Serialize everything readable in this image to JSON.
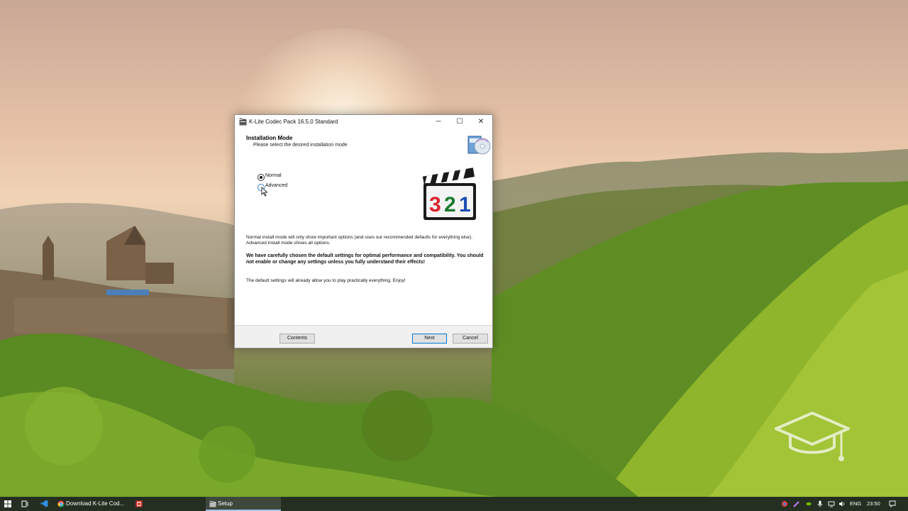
{
  "window": {
    "title": "K-Lite Codec Pack 16.5.0 Standard",
    "minimize_glyph": "─",
    "maximize_glyph": "☐",
    "close_glyph": "✕"
  },
  "page": {
    "heading": "Installation Mode",
    "subheading": "Please select the desired installation mode"
  },
  "options": [
    {
      "label": "Normal",
      "selected": true
    },
    {
      "label": "Advanced",
      "selected": false
    }
  ],
  "logo": {
    "digits": [
      "3",
      "2",
      "1"
    ],
    "colors": {
      "three": "#d9232d",
      "two": "#1a7a2e",
      "one": "#1b4fb5"
    }
  },
  "body": {
    "paragraph1": "Normal install mode will only show important options (and uses our recommended defaults for everything else). Advanced install mode shows all options.",
    "paragraph2": "We have carefully chosen the default settings for optimal performance and compatibility. You should not enable or change any settings unless you fully understand their effects!",
    "paragraph3": "The default settings will already allow you to play practically everything. Enjoy!"
  },
  "buttons": {
    "contents": "Contents",
    "next": "Next",
    "cancel": "Cancel"
  },
  "taskbar": {
    "tasks": [
      {
        "label": "Download K-Lite Cod...",
        "icon": "chrome-icon"
      },
      {
        "label": "",
        "icon": "red-app-icon"
      },
      {
        "label": "Setup",
        "icon": "setup-icon",
        "active": true
      }
    ],
    "tray": {
      "language": "ENG",
      "time": "23:50"
    }
  },
  "colors": {
    "accent": "#0078d7",
    "taskbar": "#1c2618"
  }
}
